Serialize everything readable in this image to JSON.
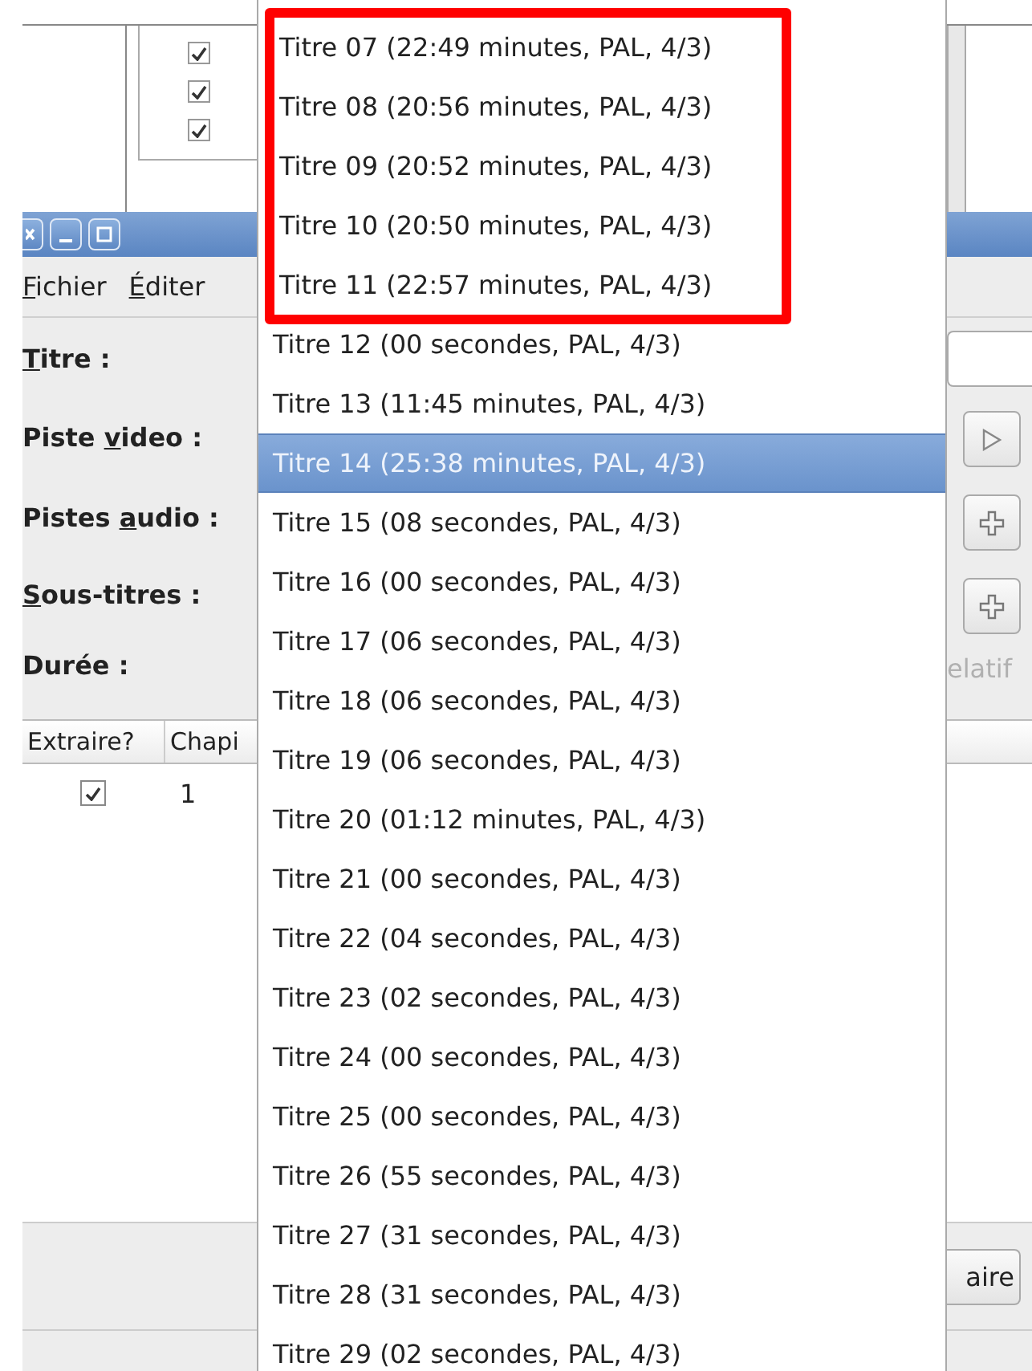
{
  "back_window": {
    "checkboxes": [
      {
        "checked": true
      },
      {
        "checked": true
      },
      {
        "checked": true
      }
    ]
  },
  "window": {
    "menu": [
      {
        "mnemonic": "F",
        "rest": "ichier"
      },
      {
        "mnemonic": "É",
        "rest": "diter"
      }
    ],
    "form_labels": [
      {
        "mnemonic": "T",
        "rest": "itre :"
      },
      {
        "prefix": "Piste ",
        "mnemonic": "v",
        "rest": "ideo :"
      },
      {
        "prefix": "Pistes ",
        "mnemonic": "a",
        "rest": "udio :"
      },
      {
        "mnemonic": "S",
        "rest": "ous-titres :"
      },
      {
        "prefix": "Durée :"
      }
    ],
    "side_buttons": [
      {
        "kind": "play"
      },
      {
        "kind": "add"
      },
      {
        "kind": "add"
      }
    ],
    "side_label": {
      "text": "elatif",
      "disabled": true
    },
    "table": {
      "columns": [
        "Extraire?",
        "Chapi"
      ],
      "rows": [
        {
          "checked": true,
          "column_2": "1"
        }
      ]
    },
    "bottom_button": "aire"
  },
  "popup": {
    "items": [
      {
        "label": "Titre 07 (22:49 minutes, PAL, 4/3)",
        "selected": false,
        "outlined": true
      },
      {
        "label": "Titre 08 (20:56 minutes, PAL, 4/3)",
        "selected": false,
        "outlined": true
      },
      {
        "label": "Titre 09 (20:52 minutes, PAL, 4/3)",
        "selected": false,
        "outlined": true
      },
      {
        "label": "Titre 10 (20:50 minutes, PAL, 4/3)",
        "selected": false,
        "outlined": true
      },
      {
        "label": "Titre 11 (22:57 minutes, PAL, 4/3)",
        "selected": false,
        "outlined": true
      },
      {
        "label": "Titre 12 (00 secondes, PAL, 4/3)",
        "selected": false,
        "outlined": false
      },
      {
        "label": "Titre 13 (11:45 minutes, PAL, 4/3)",
        "selected": false,
        "outlined": false
      },
      {
        "label": "Titre 14 (25:38 minutes, PAL, 4/3)",
        "selected": true,
        "outlined": false
      },
      {
        "label": "Titre 15 (08 secondes, PAL, 4/3)",
        "selected": false,
        "outlined": false
      },
      {
        "label": "Titre 16 (00 secondes, PAL, 4/3)",
        "selected": false,
        "outlined": false
      },
      {
        "label": "Titre 17 (06 secondes, PAL, 4/3)",
        "selected": false,
        "outlined": false
      },
      {
        "label": "Titre 18 (06 secondes, PAL, 4/3)",
        "selected": false,
        "outlined": false
      },
      {
        "label": "Titre 19 (06 secondes, PAL, 4/3)",
        "selected": false,
        "outlined": false
      },
      {
        "label": "Titre 20 (01:12 minutes, PAL, 4/3)",
        "selected": false,
        "outlined": false
      },
      {
        "label": "Titre 21 (00 secondes, PAL, 4/3)",
        "selected": false,
        "outlined": false
      },
      {
        "label": "Titre 22 (04 secondes, PAL, 4/3)",
        "selected": false,
        "outlined": false
      },
      {
        "label": "Titre 23 (02 secondes, PAL, 4/3)",
        "selected": false,
        "outlined": false
      },
      {
        "label": "Titre 24 (00 secondes, PAL, 4/3)",
        "selected": false,
        "outlined": false
      },
      {
        "label": "Titre 25 (00 secondes, PAL, 4/3)",
        "selected": false,
        "outlined": false
      },
      {
        "label": "Titre 26 (55 secondes, PAL, 4/3)",
        "selected": false,
        "outlined": false
      },
      {
        "label": "Titre 27 (31 secondes, PAL, 4/3)",
        "selected": false,
        "outlined": false
      },
      {
        "label": "Titre 28 (31 secondes, PAL, 4/3)",
        "selected": false,
        "outlined": false
      },
      {
        "label": "Titre 29 (02 secondes, PAL, 4/3)",
        "selected": false,
        "outlined": false
      }
    ]
  }
}
